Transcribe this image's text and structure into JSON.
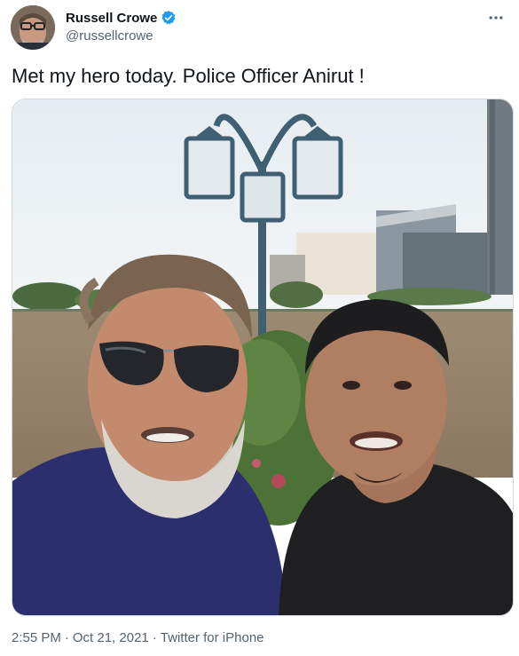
{
  "author": {
    "name": "Russell Crowe",
    "handle": "@russellcrowe",
    "verified": true
  },
  "icons": {
    "verified": "verified-badge-icon",
    "more": "more-horizontal-icon"
  },
  "tweet": {
    "text": "Met my hero today. Police Officer Anirut !"
  },
  "meta": {
    "time": "2:55 PM",
    "separator": "·",
    "date": "Oct 21, 2021",
    "source": "Twitter for iPhone"
  },
  "colors": {
    "verified_blue": "#1d9bf0",
    "secondary_text": "#536471",
    "primary_text": "#0f1419",
    "border": "#cfd9de"
  }
}
